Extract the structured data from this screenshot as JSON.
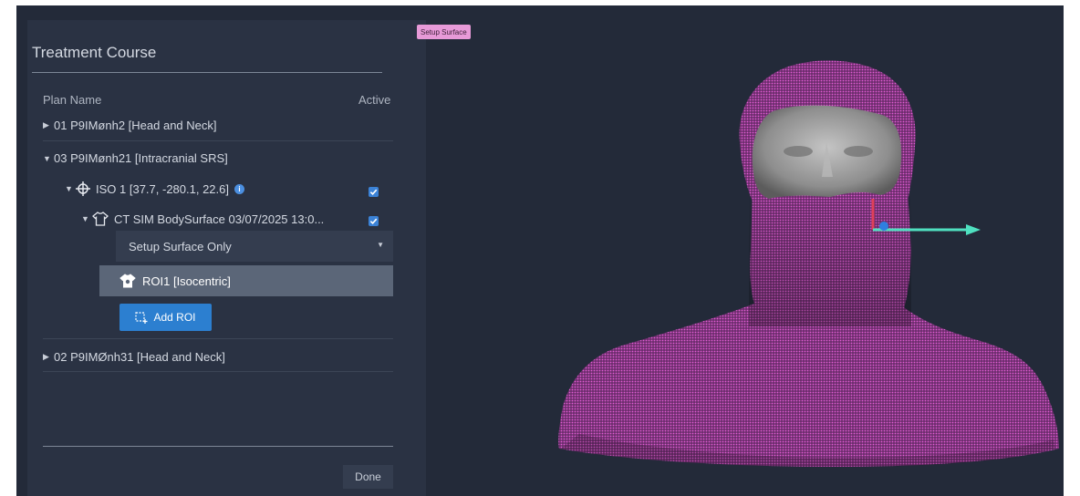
{
  "panel": {
    "title": "Treatment Course",
    "columns": {
      "plan_name": "Plan Name",
      "active": "Active"
    },
    "plans": [
      {
        "label": "01 P9IMønh2 [Head and Neck]",
        "expanded": false
      },
      {
        "label": "03 P9IMønh21 [Intracranial SRS]",
        "expanded": true
      },
      {
        "label": "02 P9IMØnh31 [Head and Neck]",
        "expanded": false
      }
    ],
    "iso": {
      "label": "ISO 1 [37.7, -280.1, 22.6]",
      "active": true,
      "info_icon": "i"
    },
    "surface": {
      "label": "CT SIM BodySurface 03/07/2025 13:0...",
      "active": true
    },
    "mode_select": {
      "value": "Setup Surface Only"
    },
    "roi": {
      "label": "ROI1 [Isocentric]"
    },
    "add_roi_label": "Add ROI",
    "done_label": "Done"
  },
  "viewport": {
    "tag": "Setup Surface",
    "colors": {
      "surface_mesh": "#d84fc6",
      "face": "#9a9a9a",
      "axis_x": "#4fe0c0",
      "axis_y": "#e0405a",
      "axis_z": "#2f7fe0"
    }
  },
  "colors": {
    "background": "#232a39",
    "panel": "#2a3243",
    "accent": "#2c7fd0",
    "selected_row": "#5b6678"
  }
}
